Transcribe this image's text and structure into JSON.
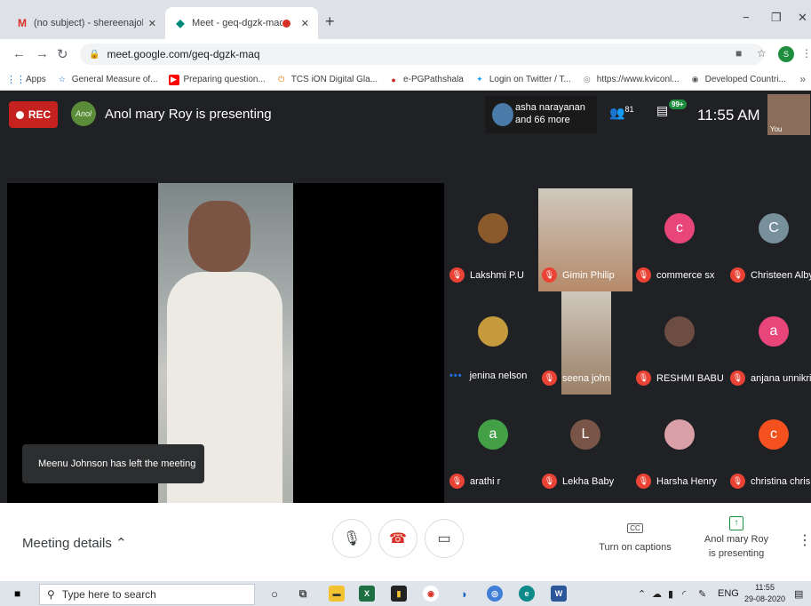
{
  "browser": {
    "tabs": [
      {
        "title": "(no subject) - shereenajohn@stu",
        "icon": "gmail-icon"
      },
      {
        "title": "Meet - geq-dgzk-maq",
        "icon": "meet-icon",
        "recording": true
      }
    ],
    "url": "meet.google.com/geq-dgzk-maq",
    "profile_initial": "S",
    "bookmarks": [
      {
        "label": "Apps",
        "icon": "apps-grid-icon"
      },
      {
        "label": "General Measure of...",
        "icon": "star-icon"
      },
      {
        "label": "Preparing question...",
        "icon": "youtube-icon"
      },
      {
        "label": "TCS iON Digital Gla...",
        "icon": "tcs-icon"
      },
      {
        "label": "e-PGPathshala",
        "icon": "epg-icon"
      },
      {
        "label": "Login on Twitter / T...",
        "icon": "twitter-icon"
      },
      {
        "label": "https://www.kviconl...",
        "icon": "web-icon"
      },
      {
        "label": "Developed Countri...",
        "icon": "globe-icon"
      }
    ]
  },
  "meet": {
    "rec_label": "REC",
    "presenter_text": "Anol mary Roy is presenting",
    "presenter_initials": "Anol",
    "participants_summary": "asha narayanan\nand 66 more",
    "participant_count": "81",
    "chat_badge": "99+",
    "time": "11:55 AM",
    "self_label": "You",
    "toast": "Meenu Johnson has left the meeting",
    "tiles": [
      {
        "name": "Lakshmi P.U",
        "type": "photo",
        "color": "#8a5a2b",
        "muted": true
      },
      {
        "name": "Gimin Philip",
        "type": "video",
        "color": "#b58a6a",
        "muted": true
      },
      {
        "name": "commerce sx",
        "type": "letter",
        "letter": "c",
        "color": "#e8457a",
        "muted": true
      },
      {
        "name": "Christeen Alby",
        "type": "letter",
        "letter": "C",
        "color": "#78909c",
        "muted": true
      },
      {
        "name": "jenina nelson",
        "type": "photo",
        "color": "#c49a3c",
        "muted": false
      },
      {
        "name": "seena john",
        "type": "video",
        "color": "#9b7f66",
        "muted": true
      },
      {
        "name": "RESHMI BABU",
        "type": "photo",
        "color": "#6d4c41",
        "muted": true
      },
      {
        "name": "anjana unnikrishnan",
        "type": "letter",
        "letter": "a",
        "color": "#e8457a",
        "muted": true
      },
      {
        "name": "arathi r",
        "type": "letter",
        "letter": "a",
        "color": "#43a047",
        "muted": true
      },
      {
        "name": "Lekha Baby",
        "type": "letter",
        "letter": "L",
        "color": "#795548",
        "muted": true
      },
      {
        "name": "Harsha Henry",
        "type": "photo",
        "color": "#d9a0a8",
        "muted": true
      },
      {
        "name": "christina chris",
        "type": "letter",
        "letter": "c",
        "color": "#f4511e",
        "muted": true
      }
    ]
  },
  "controls": {
    "meeting_details": "Meeting details",
    "captions": "Turn on captions",
    "captions_icon": "CC",
    "present_line1": "Anol mary Roy",
    "present_line2": "is presenting"
  },
  "taskbar": {
    "search_placeholder": "Type here to search",
    "lang": "ENG",
    "time": "11:55",
    "date": "29-08-2020"
  }
}
